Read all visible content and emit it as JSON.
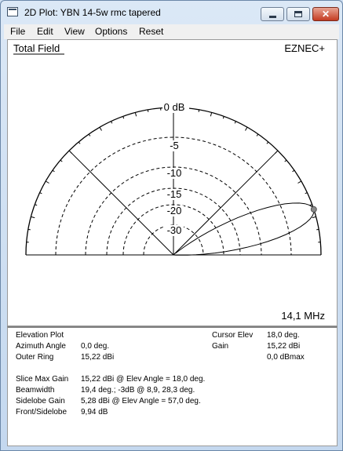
{
  "window": {
    "title": "2D Plot: YBN 14-5w rmc tapered"
  },
  "menu": {
    "file": "File",
    "edit": "Edit",
    "view": "View",
    "options": "Options",
    "reset": "Reset"
  },
  "plot": {
    "mode_label": "Total Field",
    "program": "EZNEC+",
    "frequency": "14,1 MHz",
    "ring_labels": [
      "0 dB",
      "-5",
      "-10",
      "-15",
      "-20",
      "-30"
    ],
    "pattern_color": "#000000",
    "cursor_elev_deg": 18.0,
    "main_lobe_elev_deg": 18.0,
    "sidelobe_elev_deg": 57.0
  },
  "info": {
    "elevation_plot": "Elevation Plot",
    "azimuth_angle_label": "Azimuth Angle",
    "azimuth_angle_value": "0,0 deg.",
    "outer_ring_label": "Outer Ring",
    "outer_ring_value": "15,22 dBi",
    "cursor_elev_label": "Cursor Elev",
    "cursor_elev_value": "18,0 deg.",
    "gain_label": "Gain",
    "gain_value": "15,22 dBi",
    "gain_rel_value": "0,0 dBmax",
    "slice_max_gain_label": "Slice Max Gain",
    "slice_max_gain_value": "15,22 dBi @ Elev Angle = 18,0 deg.",
    "beamwidth_label": "Beamwidth",
    "beamwidth_value": "19,4 deg.; -3dB @ 8,9, 28,3 deg.",
    "sidelobe_gain_label": "Sidelobe Gain",
    "sidelobe_gain_value": "5,28 dBi @ Elev Angle = 57,0 deg.",
    "front_sidelobe_label": "Front/Sidelobe",
    "front_sidelobe_value": "9,94 dB"
  }
}
